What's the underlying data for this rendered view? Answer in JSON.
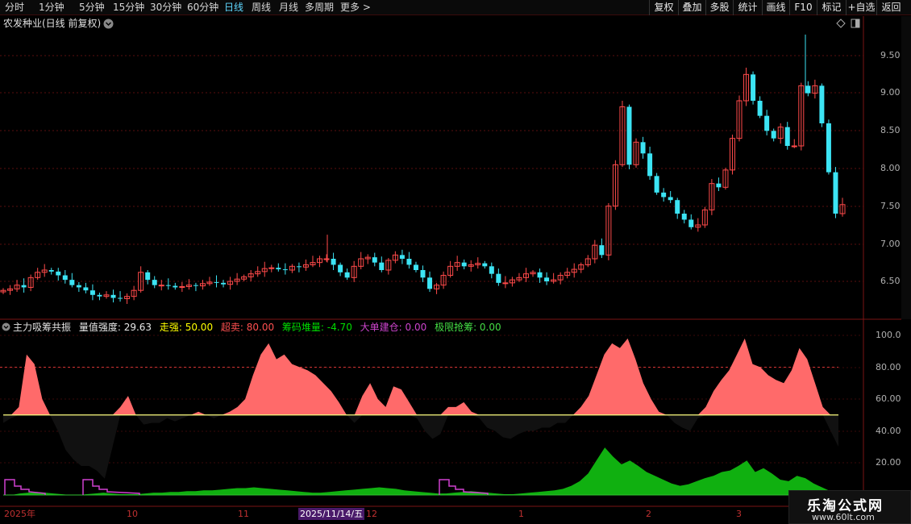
{
  "toolbar": {
    "periods": [
      {
        "label": "分时",
        "active": false
      },
      {
        "label": "1分钟",
        "active": false
      },
      {
        "label": "5分钟",
        "active": false
      },
      {
        "label": "15分钟",
        "active": false
      },
      {
        "label": "30分钟",
        "active": false
      },
      {
        "label": "60分钟",
        "active": false
      },
      {
        "label": "日线",
        "active": true
      },
      {
        "label": "周线",
        "active": false
      },
      {
        "label": "月线",
        "active": false
      },
      {
        "label": "多周期",
        "active": false
      },
      {
        "label": "更多",
        "active": false
      }
    ],
    "more_arrow": ">",
    "buttons": [
      "复权",
      "叠加",
      "多股",
      "统计",
      "画线",
      "F10",
      "标记",
      "+自选",
      "返回"
    ]
  },
  "chart": {
    "title": "农发种业(日线 前复权)",
    "price_ticks": [
      "9.50",
      "9.00",
      "8.50",
      "8.00",
      "7.50",
      "7.00",
      "6.50"
    ],
    "up_color": "#ff4040",
    "down_color": "#38e0f0"
  },
  "indicator": {
    "name": "主力吸筹共振",
    "values": [
      {
        "label": "量值强度:",
        "value": "29.63",
        "color": "#e8e8e8"
      },
      {
        "label": "走强:",
        "value": "50.00",
        "color": "#ffff00"
      },
      {
        "label": "超卖:",
        "value": "80.00",
        "color": "#ff5050"
      },
      {
        "label": "筹码堆量:",
        "value": "-4.70",
        "color": "#00dd00"
      },
      {
        "label": "大单建仓:",
        "value": "0.00",
        "color": "#cc44cc"
      },
      {
        "label": "极限抢筹:",
        "value": "0.00",
        "color": "#44dd44"
      }
    ],
    "ticks": [
      "100.0",
      "80.00",
      "60.00",
      "40.00",
      "20.00"
    ]
  },
  "dates": [
    "2025年",
    "10",
    "11",
    "2025/11/14/五",
    "12",
    "1",
    "2",
    "3"
  ],
  "watermark": {
    "title": "乐淘公式网",
    "url": "www.60lt.com"
  }
}
